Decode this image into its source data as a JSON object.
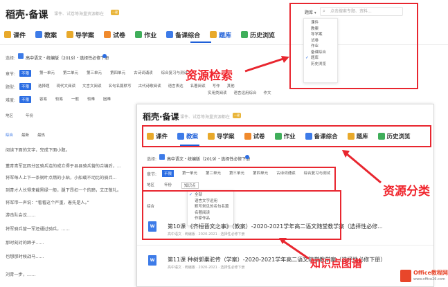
{
  "back": {
    "logo": "稻壳·备课",
    "slogan": "课件、试卷等海量资源都在",
    "slogan_tag": "一键",
    "search": {
      "category": "题库",
      "placeholder": "点击搜索专题、资料..."
    },
    "dropdown_items": [
      "课件",
      "教案",
      "导学案",
      "试卷",
      "作业",
      "备课综合",
      "题库",
      "历史浏览"
    ],
    "dropdown_selected": "题库",
    "nav_tabs": [
      {
        "label": "课件",
        "color": "#e8a92b"
      },
      {
        "label": "教案",
        "color": "#3d7be8"
      },
      {
        "label": "导学案",
        "color": "#e8a92b"
      },
      {
        "label": "试卷",
        "color": "#f08a2d"
      },
      {
        "label": "作业",
        "color": "#3fae5a"
      },
      {
        "label": "备课综合",
        "color": "#3d7be8"
      },
      {
        "label": "题库",
        "color": "#e8a92b"
      },
      {
        "label": "历史浏览",
        "color": "#3fae5a"
      }
    ],
    "active_tab": "题库",
    "select_label": "选择:",
    "book": "高中语文・统编版（2019）・选择性必修下册",
    "row1_label": "章节:",
    "row1_chips": [
      "不限",
      "第一单元",
      "第二单元",
      "第三单元",
      "第四单元",
      "古诗词诵读",
      "综合复习与测试"
    ],
    "row2_label": "题型:",
    "row2_chips": [
      "不限",
      "选择题",
      "现代文阅读",
      "文言文阅读",
      "名句名篇默写",
      "古代诗歌阅读",
      "语言表达",
      "名著阅读",
      "写作",
      "其他"
    ],
    "row2b_chips": [
      "实用类阅读",
      "语言运用综合",
      "作文"
    ],
    "row3_label": "难度:",
    "row3_chips": [
      "不限",
      "容易",
      "较易",
      "一般",
      "较难",
      "困难"
    ],
    "filter_left": [
      "地区",
      "年份"
    ],
    "sort_tabs": [
      "综合",
      "最新",
      "最热"
    ],
    "intro": "阅读下面的文字，完成下面小题。",
    "paragraphs": [
      "董青青军区四分区骑兵连的成立得于县县骑兵营的合编后，...",
      "将军每人上下一条钢叶点燃的小贴，小船载不动比的骑兵...",
      "到青才人长得来截黑绿一般，腿下昂扣一个的蹄，立正敬礼。",
      "将军带一声说：“看看这个严重，着先是人。”",
      "游击队会议……"
    ],
    "body_lines": [
      "将军骑兵营一军还通过骑兵，……",
      "那时刻对的蹄子……",
      "也想那时候战马……",
      "刘青一步，……"
    ]
  },
  "front": {
    "logo": "稻壳·备课",
    "slogan": "课件、试卷等海量资源都在",
    "slogan_tag": "一键",
    "nav_tabs": [
      {
        "label": "课件",
        "color": "#e8a92b"
      },
      {
        "label": "教案",
        "color": "#3d7be8"
      },
      {
        "label": "导学案",
        "color": "#e8a92b"
      },
      {
        "label": "试卷",
        "color": "#f08a2d"
      },
      {
        "label": "作业",
        "color": "#3fae5a"
      },
      {
        "label": "备课综合",
        "color": "#3d7be8"
      },
      {
        "label": "题库",
        "color": "#e8a92b"
      },
      {
        "label": "历史浏览",
        "color": "#3fae5a"
      }
    ],
    "active_tab": "教案",
    "select_label": "选择:",
    "book": "高中语文・统编版（2019）・选择性必修下册",
    "chapter_label": "章节:",
    "chapter_chips": [
      "不限",
      "第一单元",
      "第二单元",
      "第三单元",
      "第四单元",
      "古诗词诵读",
      "综合复习与测试"
    ],
    "filters": [
      "地区",
      "年份",
      "知识点"
    ],
    "sort_label": "综合",
    "kp_items": [
      "全部",
      "语言文字运用",
      "默写常见的名句名篇",
      "名著阅读",
      "作家作品"
    ],
    "kp_selected": "全部",
    "docs": [
      {
        "title": "第10课 《齐桓晋文之事》（教案）-2020-2021学年高二语文随堂教学案（选择性必修...",
        "meta": "高中语文 · 统编版 · 2020-2021 · 选择性必修下册"
      },
      {
        "title": "第11课 种树郭橐驼传（学案）-2020-2021学年高二语文随堂教学案（选择性必修下册）",
        "meta": "高中语文 · 统编版 · 2020-2021 · 选择性必修下册"
      }
    ]
  },
  "annotations": {
    "search": "资源检索",
    "category": "资源分类",
    "knowledge": "知识点图谱"
  },
  "badge": {
    "brand": "Office教程网",
    "url": "www.office26.com"
  }
}
